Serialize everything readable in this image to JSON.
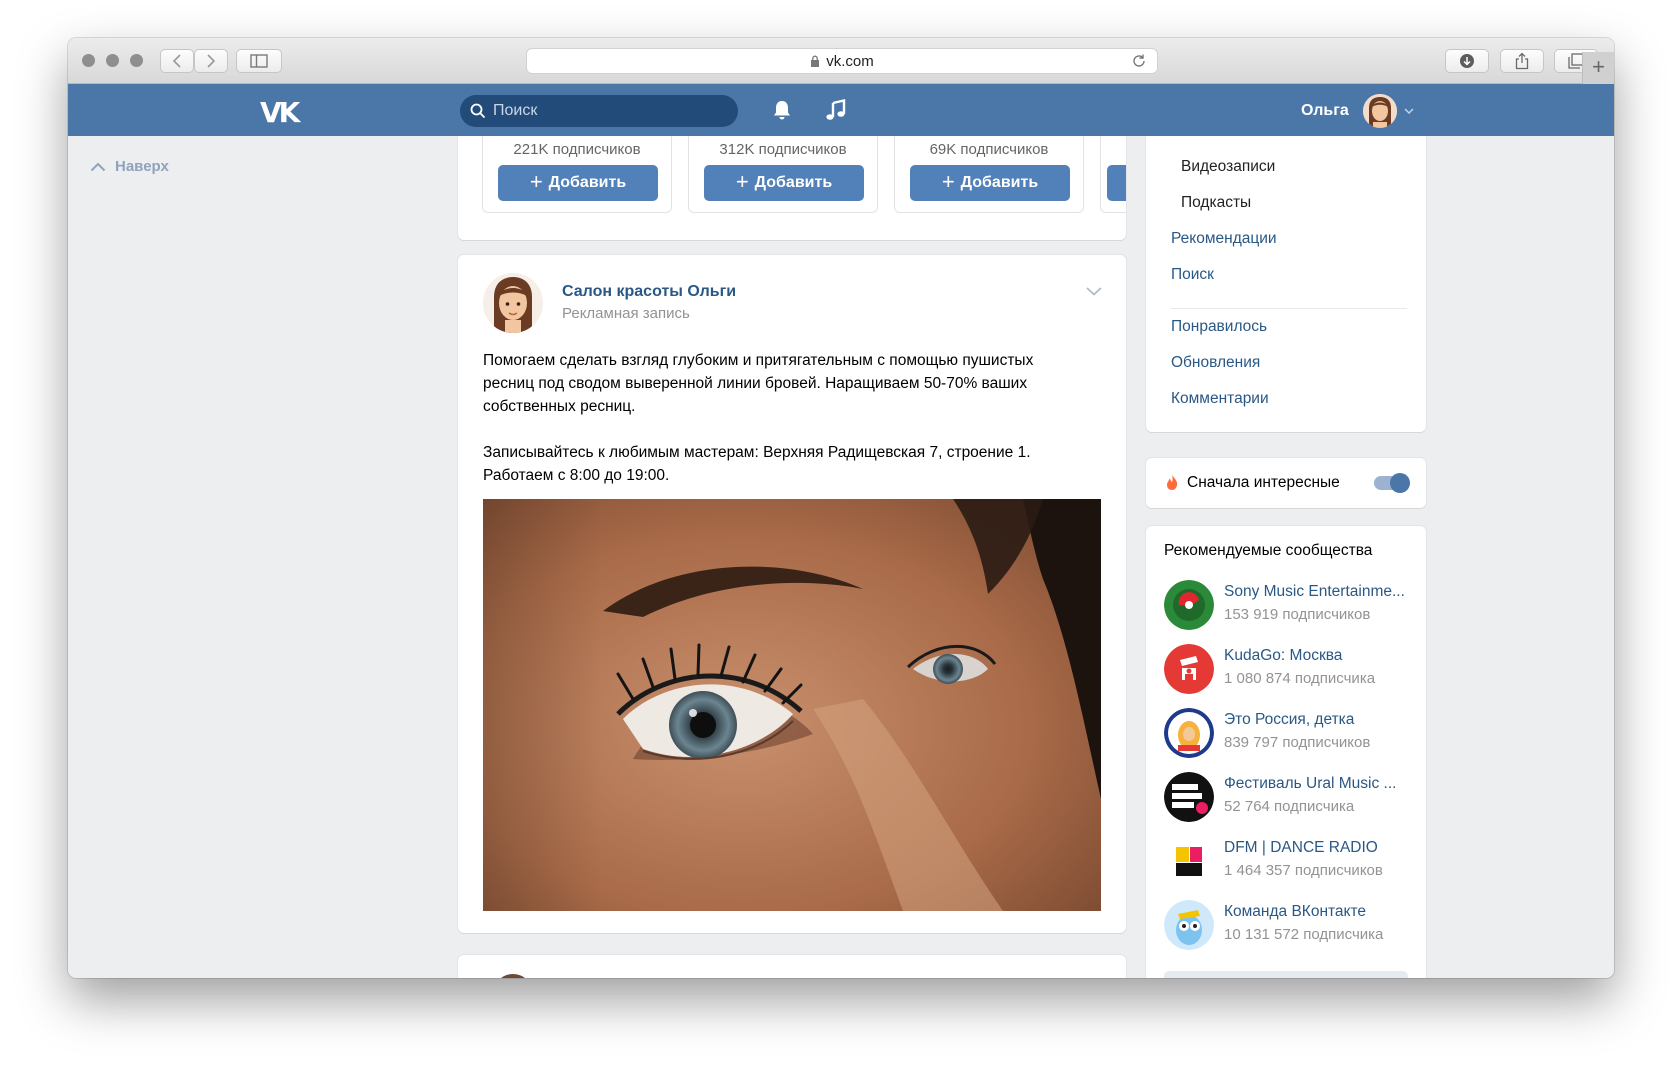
{
  "browser": {
    "url": "vk.com"
  },
  "header": {
    "logo": "VK",
    "search_placeholder": "Поиск",
    "user_name": "Ольга"
  },
  "left": {
    "back_to_top": "Наверх"
  },
  "carousel": {
    "items": [
      {
        "subscribers": "221K подписчиков",
        "button": "Добавить"
      },
      {
        "subscribers": "312K подписчиков",
        "button": "Добавить"
      },
      {
        "subscribers": "69K подписчиков",
        "button": "Добавить"
      }
    ]
  },
  "post": {
    "author": "Салон красоты Ольги",
    "label": "Рекламная запись",
    "paragraphs": [
      "Помогаем сделать взгляд глубоким и притягательным с помощью пушистых\nресниц под сводом выверенной линии бровей. Наращиваем 50-70% ваших\nсобственных ресниц.",
      "Записывайтесь к любимым мастерам: Верхняя Радищевская 7, строение 1.\nРаботаем с 8:00 до 19:00."
    ]
  },
  "menu": {
    "sub_items": [
      "Видеозаписи",
      "Подкасты"
    ],
    "items": [
      "Рекомендации",
      "Поиск"
    ],
    "items2": [
      "Понравилось",
      "Обновления",
      "Комментарии"
    ]
  },
  "feed_toggle": {
    "label": "Сначала интересные",
    "on": true
  },
  "recommended": {
    "title": "Рекомендуемые сообщества",
    "groups": [
      {
        "name": "Sony Music Entertainme...",
        "subscribers": "153 919 подписчиков",
        "color": "#2a8a3a"
      },
      {
        "name": "KudaGo: Москва",
        "subscribers": "1 080 874 подписчика",
        "color": "#e53935"
      },
      {
        "name": "Это Россия, детка",
        "subscribers": "839 797 подписчиков",
        "color": "#1e3a8a"
      },
      {
        "name": "Фестиваль Ural Music ...",
        "subscribers": "52 764 подписчика",
        "color": "#111111"
      },
      {
        "name": "DFM | DANCE RADIO",
        "subscribers": "1 464 357 подписчиков",
        "color": "#f5c400"
      },
      {
        "name": "Команда ВКонтакте",
        "subscribers": "10 131 572 подписчика",
        "color": "#7ec3f0"
      }
    ]
  },
  "colors": {
    "vk_blue": "#4a76a8",
    "button_blue": "#5181b8",
    "link": "#2a5885",
    "background": "#edeef0"
  }
}
